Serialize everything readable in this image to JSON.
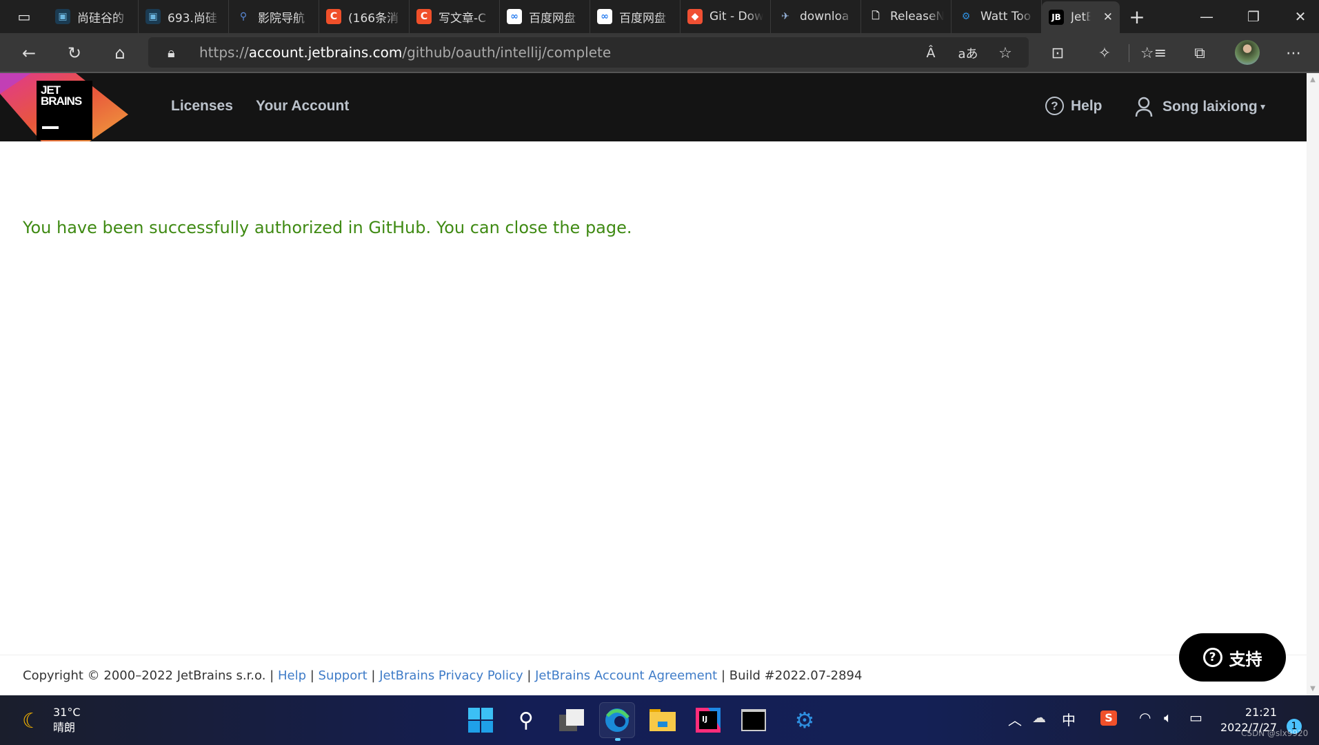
{
  "browser": {
    "tabs": [
      {
        "label": "尚硅谷的",
        "icon": "bilibili-icon"
      },
      {
        "label": "693.尚硅",
        "icon": "bilibili-icon"
      },
      {
        "label": "影院导航",
        "icon": "search-icon"
      },
      {
        "label": "(166条消",
        "icon": "csdn-icon"
      },
      {
        "label": "写文章-C",
        "icon": "csdn-icon"
      },
      {
        "label": "百度网盘",
        "icon": "baidu-netdisk-icon"
      },
      {
        "label": "百度网盘",
        "icon": "baidu-netdisk-icon"
      },
      {
        "label": "Git - Dow",
        "icon": "git-icon"
      },
      {
        "label": "downloa",
        "icon": "download-icon"
      },
      {
        "label": "ReleaseN",
        "icon": "page-icon"
      },
      {
        "label": "Watt Too",
        "icon": "watt-toolkit-icon"
      },
      {
        "label": "JetBr",
        "icon": "jetbrains-icon",
        "active": true
      }
    ],
    "jb_fav": "JB",
    "url_prefix": "https://",
    "url_domain": "account.jetbrains.com",
    "url_path": "/github/oauth/intellij/complete",
    "read_aloud": "Â",
    "translate": "aあ"
  },
  "header": {
    "logo_line1": "JET",
    "logo_line2": "BRAINS",
    "nav": [
      {
        "label": "Licenses"
      },
      {
        "label": "Your Account"
      }
    ],
    "help": "Help",
    "user": "Song laixiong"
  },
  "main": {
    "message": "You have been successfully authorized in GitHub. You can close the page."
  },
  "footer": {
    "copyright": "Copyright © 2000–2022 JetBrains s.r.o.",
    "links": [
      "Help",
      "Support",
      "JetBrains Privacy Policy",
      "JetBrains Account Agreement"
    ],
    "build": "Build #2022.07-2894",
    "sep": " | "
  },
  "support_button": {
    "label": "支持"
  },
  "taskbar": {
    "weather_temp": "31°C",
    "weather_desc": "晴朗",
    "ime": "中",
    "time": "21:21",
    "date": "2022/7/27",
    "notifications": "1",
    "watermark": "CSDN @slx9920"
  },
  "colors": {
    "success": "#3f8a13",
    "link": "#3f7cc8",
    "header_bg": "#141414"
  }
}
